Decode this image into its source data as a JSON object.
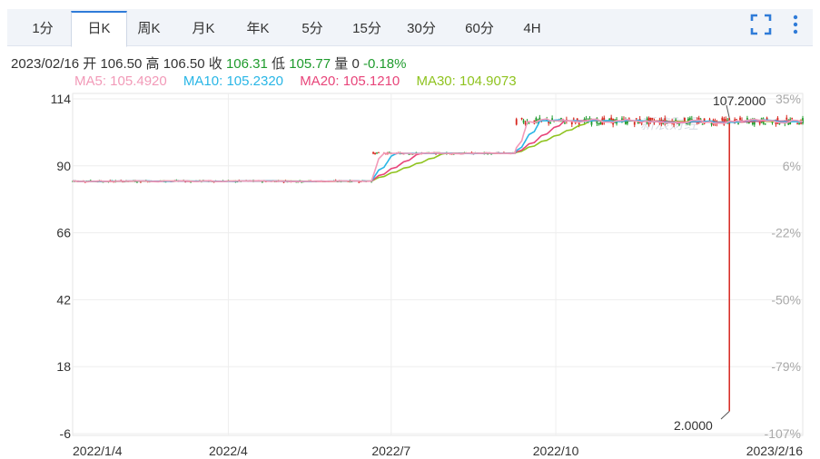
{
  "tabs": [
    {
      "label": "1分"
    },
    {
      "label": "日K",
      "active": true
    },
    {
      "label": "周K"
    },
    {
      "label": "月K"
    },
    {
      "label": "年K"
    },
    {
      "label": "5分"
    },
    {
      "label": "15分"
    },
    {
      "label": "30分"
    },
    {
      "label": "60分"
    },
    {
      "label": "4H"
    }
  ],
  "toolbar": {
    "fullscreen_icon": "fullscreen-icon",
    "more_icon": "more-vertical-icon"
  },
  "info": {
    "date": "2023/02/16",
    "open_label": "开",
    "open": "106.50",
    "high_label": "高",
    "high": "106.50",
    "close_label": "收",
    "close": "106.31",
    "low_label": "低",
    "low": "105.77",
    "volume_label": "量",
    "volume": "0",
    "change": "-0.18%"
  },
  "ma": {
    "ma5": "MA5: 105.4920",
    "ma10": "MA10: 105.2320",
    "ma20": "MA20: 105.1210",
    "ma30": "MA30: 104.9073"
  },
  "colors": {
    "ma5": "#f29ab8",
    "ma10": "#29b6e6",
    "ma20": "#e8457a",
    "ma30": "#8fc31f",
    "up": "#1f9b2d",
    "down": "#d7261e",
    "accent": "#2f7bd8"
  },
  "chart_data": {
    "type": "candlestick",
    "title": "",
    "x_ticks": [
      "2022/1/4",
      "2022/4",
      "2022/7",
      "2022/10",
      "2023/2/16"
    ],
    "y_ticks": [
      114,
      90,
      66,
      42,
      18,
      -6
    ],
    "pct_ticks": [
      "35%",
      "6%",
      "-22%",
      "-50%",
      "-79%",
      "-107%"
    ],
    "ylim": [
      -6,
      114
    ],
    "max_label": "107.2000",
    "min_label": "2.0000",
    "watermark": "新浪财经",
    "levels": [
      {
        "from": "2022/1/4",
        "to": "2022/6/20",
        "price": 84.5
      },
      {
        "from": "2022/6/21",
        "to": "2022/9/8",
        "price": 94.5
      },
      {
        "from": "2022/9/9",
        "to": "2023/2/16",
        "price": 106.0
      }
    ],
    "spike": {
      "date": "2023/1/6",
      "high": 107.2,
      "low": 2.0
    },
    "ma_last": {
      "ma5": 105.492,
      "ma10": 105.232,
      "ma20": 105.121,
      "ma30": 104.9073
    },
    "grid": true
  }
}
